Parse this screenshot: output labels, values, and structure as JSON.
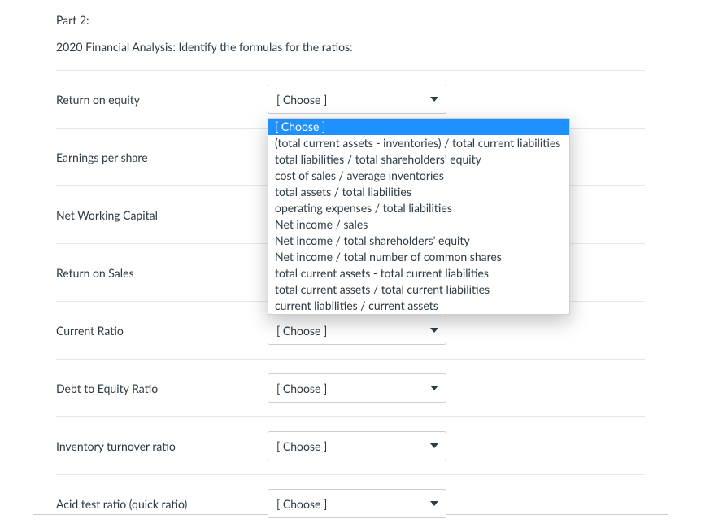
{
  "header": {
    "part_label": "Part 2:",
    "subtitle": "2020 Financial Analysis: Identify the formulas for the ratios:"
  },
  "choose_label": "[ Choose ]",
  "items": [
    {
      "label": "Return on equity"
    },
    {
      "label": "Earnings per share"
    },
    {
      "label": "Net Working Capital"
    },
    {
      "label": "Return on Sales"
    },
    {
      "label": "Current Ratio"
    },
    {
      "label": "Debt to Equity Ratio"
    },
    {
      "label": "Inventory turnover ratio"
    },
    {
      "label": "Acid test ratio (quick ratio)"
    }
  ],
  "dropdown_options": [
    "[ Choose ]",
    "(total current assets - inventories) / total current liabilities",
    "total liabilities / total shareholders' equity",
    "cost of sales / average inventories",
    "total assets / total liabilities",
    "operating expenses / total liabilities",
    "Net income / sales",
    "Net income / total shareholders' equity",
    "Net income / total number of common shares",
    "total current assets - total current liabilities",
    "total current assets / total current liabilities",
    "current liabilities / current assets"
  ]
}
